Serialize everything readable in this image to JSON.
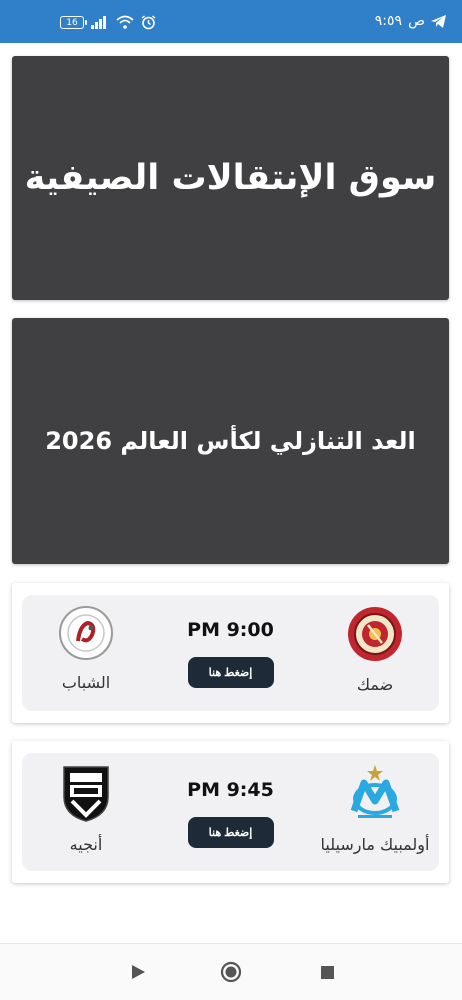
{
  "status_bar": {
    "time": "٩:٥٩",
    "ampm": "ص",
    "battery_level": "16",
    "icons": [
      "telegram-icon",
      "signal-icon",
      "wifi-icon",
      "alarm-icon",
      "battery-icon"
    ]
  },
  "banners": [
    {
      "title": "سوق الإنتقالات الصيفية"
    },
    {
      "title": "العد التنازلي لكأس العالم 2026"
    }
  ],
  "matches": [
    {
      "home_team": "ضمك",
      "away_team": "الشباب",
      "time": "PM 9:00",
      "button_label": "إضغط هنا"
    },
    {
      "home_team": "أولمبيك مارسيليا",
      "away_team": "أنجيه",
      "time": "PM 9:45",
      "button_label": "إضغط هنا"
    }
  ],
  "colors": {
    "status_bar": "#2f80c8",
    "banner_bg": "#404042",
    "button_bg": "#1f2a38",
    "damac_red": "#c0262d",
    "om_blue": "#2aa8e0"
  }
}
